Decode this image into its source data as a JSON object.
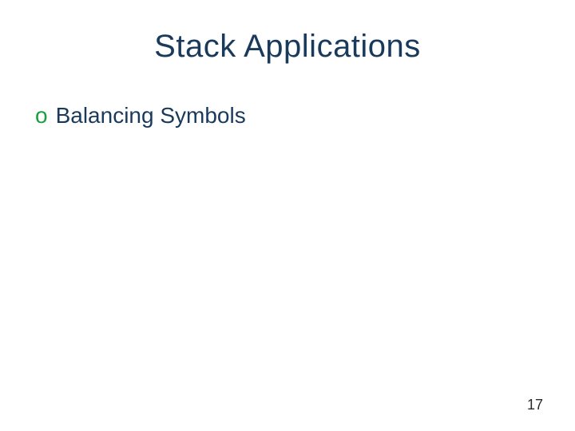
{
  "slide": {
    "title": "Stack Applications",
    "bullets": [
      {
        "marker": "o",
        "text": "Balancing Symbols"
      }
    ],
    "page_number": "17"
  },
  "colors": {
    "title_color": "#1a3a5c",
    "bullet_marker_color": "#1a9e3f",
    "bullet_text_color": "#1a3a5c"
  }
}
